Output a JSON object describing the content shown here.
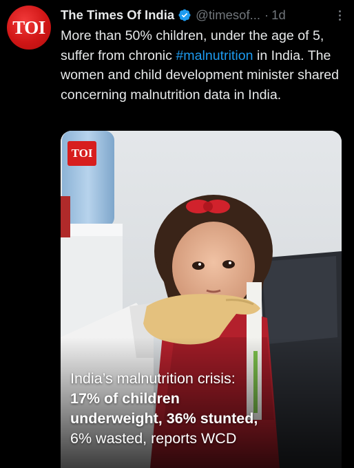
{
  "account": {
    "avatar_text": "TOI",
    "name": "The Times Of India",
    "handle": "@timesof...",
    "separator": "·",
    "time": "1d",
    "verified_icon": "verified-badge-icon",
    "more_icon": "more-options-icon"
  },
  "tweet": {
    "text_before": "More than 50% children, under the age of 5, suffer from chronic ",
    "hashtag": "#malnutrition",
    "text_after": " in India. The women and child development minister shared concerning malnutrition data in India."
  },
  "media": {
    "badge_text": "TOI",
    "headline_line1": "India’s malnutrition crisis:",
    "headline_line2": "17% of children",
    "headline_line3": "underweight, 36% stunted,",
    "headline_line4": "6% wasted, reports WCD"
  },
  "colors": {
    "background": "#000000",
    "text": "#e7e9ea",
    "secondary": "#71767b",
    "link": "#1d9bf0",
    "brand_red": "#d71e1e",
    "verified_blue": "#1d9bf0"
  }
}
